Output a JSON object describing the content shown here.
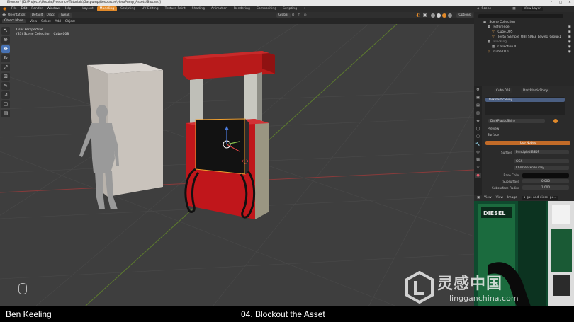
{
  "window": {
    "title": "Blender* [D:\\Projects\\Ursula\\Freelance\\Tutorials\\Gaspump\\Resources\\HeroPump_Assets\\Blocked]"
  },
  "menu": {
    "items": [
      "File",
      "Edit",
      "Render",
      "Window",
      "Help"
    ],
    "workspaces": [
      "Layout",
      "Modeling",
      "Sculpting",
      "UV Editing",
      "Texture Paint",
      "Shading",
      "Animation",
      "Rendering",
      "Compositing",
      "Scripting",
      "+"
    ],
    "active_workspace": "Modeling",
    "scene": "Scene",
    "view_layer": "View Layer"
  },
  "viewport_header": {
    "mode": "Object Mode",
    "orientation_label": "Orientation:",
    "orientation_value": "Default",
    "drag_label": "Drag:",
    "drag_value": "Tweak",
    "transform": "Global",
    "options": "Options",
    "menus": [
      "View",
      "Select",
      "Add",
      "Object"
    ]
  },
  "viewport": {
    "view_name": "User Perspective",
    "collection_info": "(83) Scene Collection | Cube.008"
  },
  "tools": [
    "tweak-icon",
    "cursor-icon",
    "move-icon",
    "rotate-icon",
    "scale-icon",
    "transform-icon",
    "annotate-icon",
    "measure-icon",
    "add-cube-icon",
    "extrude-icon"
  ],
  "outliner": {
    "root": "Scene Collection",
    "rows": [
      {
        "label": "Reference",
        "icon": "collection-icon",
        "indent": 1
      },
      {
        "label": "Cube.005",
        "icon": "mesh-icon",
        "indent": 2
      },
      {
        "label": "TestA_Sample_OBJ_SUB3_Level1_Group1",
        "icon": "mesh-icon",
        "indent": 2
      },
      {
        "label": "Blocking",
        "icon": "collection-icon",
        "indent": 1
      },
      {
        "label": "Collection 4",
        "icon": "collection-icon",
        "indent": 2
      },
      {
        "label": "Cube.010",
        "icon": "mesh-icon",
        "indent": 1
      }
    ]
  },
  "properties": {
    "object_name": "Cube.008",
    "material_name": "DarkPlasticShiny",
    "slot_name": "DarkPlasticShiny",
    "material_field": "DarkPlasticShiny",
    "preview_label": "Preview",
    "surface_label": "Surface",
    "use_nodes": "Use Nodes",
    "surface_field_label": "Surface",
    "surface_value": "Principled BSDF",
    "distribution": "GGX",
    "subsurface_method": "Christensen-Burley",
    "base_color_label": "Base Color",
    "subsurface_label": "Subsurface",
    "subsurface_value": "0.000",
    "subsurface_radius_label": "Subsurface Radius",
    "subsurface_radius_value": "1.000"
  },
  "image_editor": {
    "menus": [
      "View",
      "View",
      "Image"
    ],
    "image_name": "a-gas-and-diesel-pu...",
    "sign_text": "DIESEL"
  },
  "watermark": {
    "main": "灵感中国",
    "sub": "lingganchina.com"
  },
  "caption": {
    "author": "Ben Keeling",
    "chapter": "04. Blockout the Asset"
  },
  "colors": {
    "accent": "#e28a2a",
    "pump_red": "#b81a1a",
    "selection": "#4772b3"
  }
}
